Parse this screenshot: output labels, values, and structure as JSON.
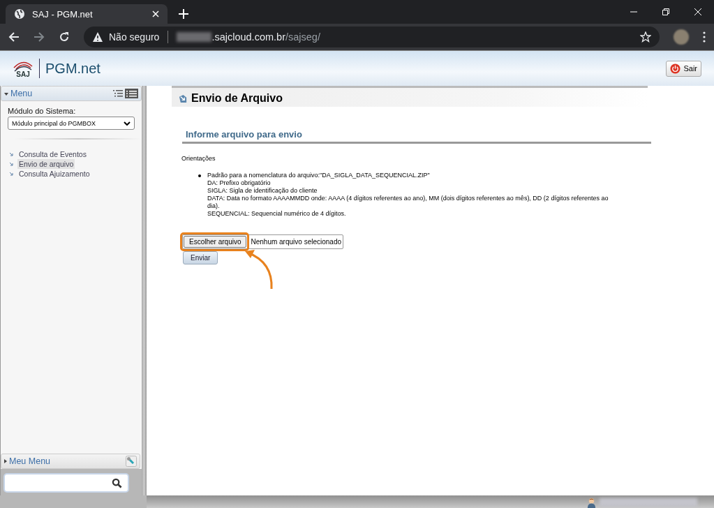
{
  "browser": {
    "tab_title": "SAJ - PGM.net",
    "security": "Não seguro",
    "host": ".sajcloud.com.br",
    "path": "/sajseg/"
  },
  "header": {
    "logo": "SAJ",
    "app_name": "PGM.net",
    "exit_button": "Sair"
  },
  "sidebar": {
    "menu_title": "Menu",
    "menu_expanded": true,
    "module_label": "Módulo do Sistema:",
    "module_value": "Módulo principal do PGMBOX",
    "items": [
      {
        "label": "Consulta de Eventos",
        "selected": false
      },
      {
        "label": "Envio de arquivo",
        "selected": true
      },
      {
        "label": "Consulta Ajuizamento",
        "selected": false
      }
    ],
    "my_menu_title": "Meu Menu",
    "my_menu_expanded": false
  },
  "content": {
    "page_title": "Envio de Arquivo",
    "section_title": "Informe arquivo para envio",
    "guidance_label": "Orientações",
    "guidance_lines": [
      "Padrão para a nomenclatura do arquivo:\"DA_SIGLA_DATA_SEQUENCIAL.ZIP\"",
      "DA: Prefixo obrigatório",
      "SIGLA: Sigla de identificação do cliente",
      "DATA: Data no formato AAAAMMDD onde: AAAA (4 dígitos referentes ao ano), MM (dois dígitos referentes ao mês), DD (2 dígitos referentes ao dia).",
      "SEQUENCIAL: Sequencial numérico de 4 dígitos."
    ],
    "file_button": "Escolher arquivo",
    "file_status": "Nenhum arquivo selecionado",
    "send_button": "Enviar"
  }
}
